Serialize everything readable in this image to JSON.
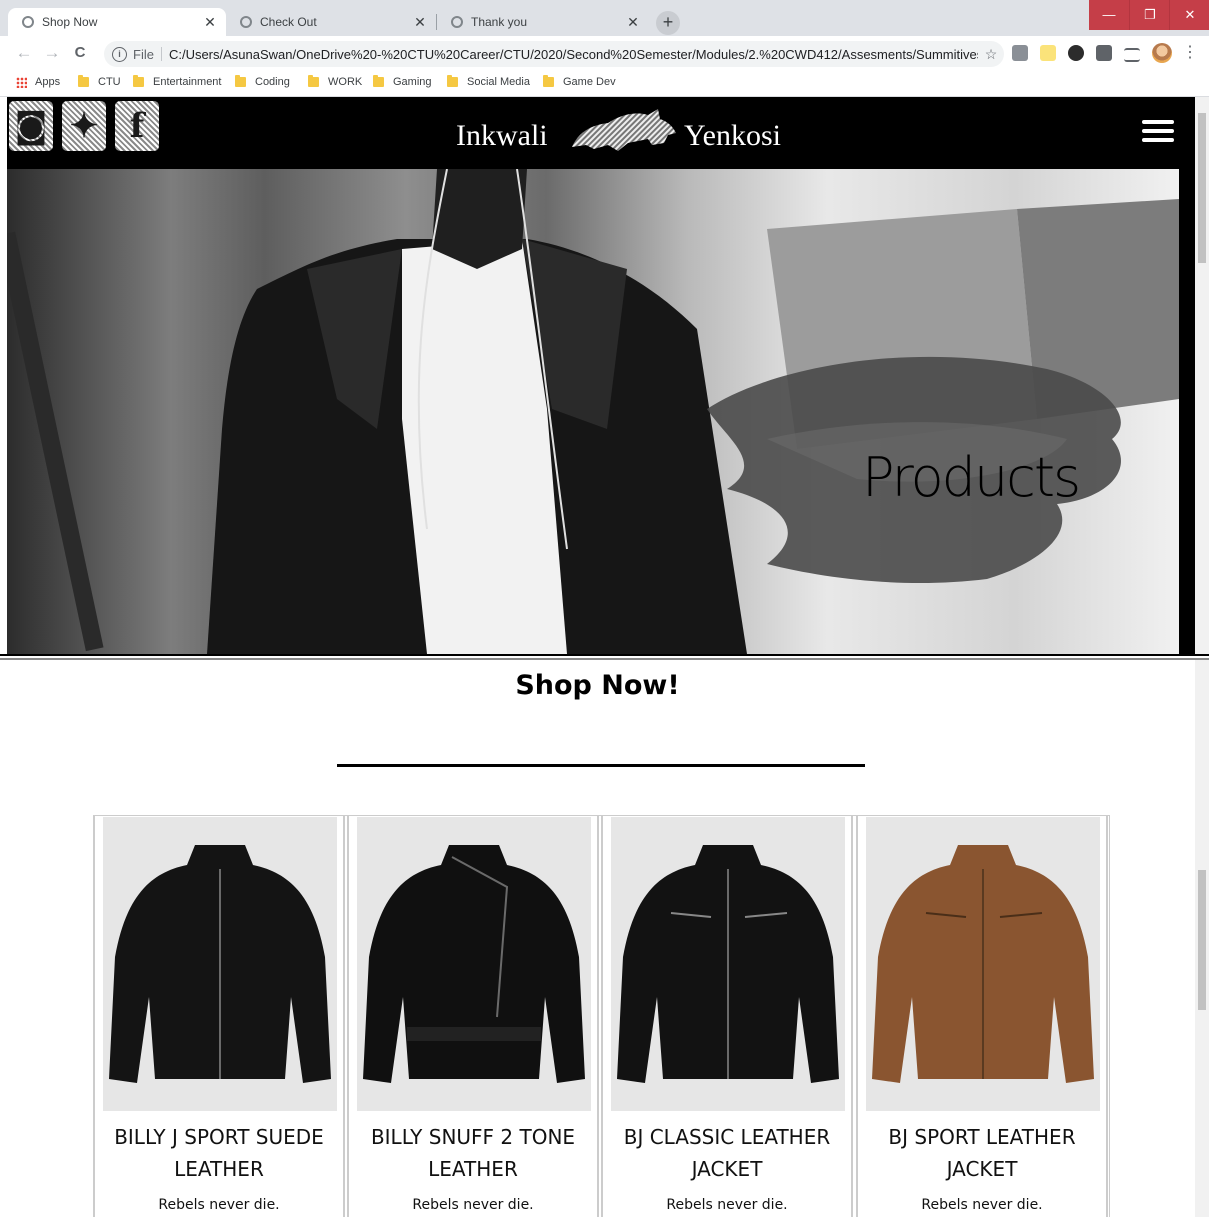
{
  "browser": {
    "tabs": [
      {
        "title": "Shop Now",
        "close": "✕"
      },
      {
        "title": "Check Out",
        "close": "✕"
      },
      {
        "title": "Thank you",
        "close": "✕"
      }
    ],
    "new_tab": "+",
    "window": {
      "minimize": "—",
      "restore": "❐",
      "close": "✕"
    },
    "nav": {
      "back": "←",
      "forward": "→",
      "reload": "C"
    },
    "omnibox": {
      "info": "i",
      "scheme_label": "File",
      "url": "C:/Users/AsunaSwan/OneDrive%20-%20CTU%20Career/CTU/2020/Second%20Semester/Modules/2.%20CWD412/Assesments/Summitives/Code...",
      "star": "☆"
    },
    "menu": "⋮",
    "bookmarks": [
      "Apps",
      "CTU",
      "Entertainment",
      "Coding",
      "WORK",
      "Gaming",
      "Social Media",
      "Game Dev"
    ]
  },
  "site": {
    "social": [
      {
        "name": "instagram",
        "glyph": "◙"
      },
      {
        "name": "twitter",
        "glyph": "✦"
      },
      {
        "name": "facebook",
        "glyph": "f"
      }
    ],
    "brand_left": "Inkwali",
    "brand_right": "Yenkosi",
    "hero_heading": "Products",
    "shop_heading": "Shop Now!",
    "products": [
      {
        "name": "BILLY J SPORT SUEDE LEATHER",
        "tagline": "Rebels never die.",
        "color": "#141414"
      },
      {
        "name": "BILLY SNUFF 2 TONE LEATHER",
        "tagline": "Rebels never die.",
        "color": "#101010"
      },
      {
        "name": "BJ CLASSIC LEATHER JACKET",
        "tagline": "Rebels never die.",
        "color": "#121212"
      },
      {
        "name": "BJ SPORT LEATHER JACKET",
        "tagline": "Rebels never die.",
        "color": "#8a5530"
      }
    ]
  }
}
